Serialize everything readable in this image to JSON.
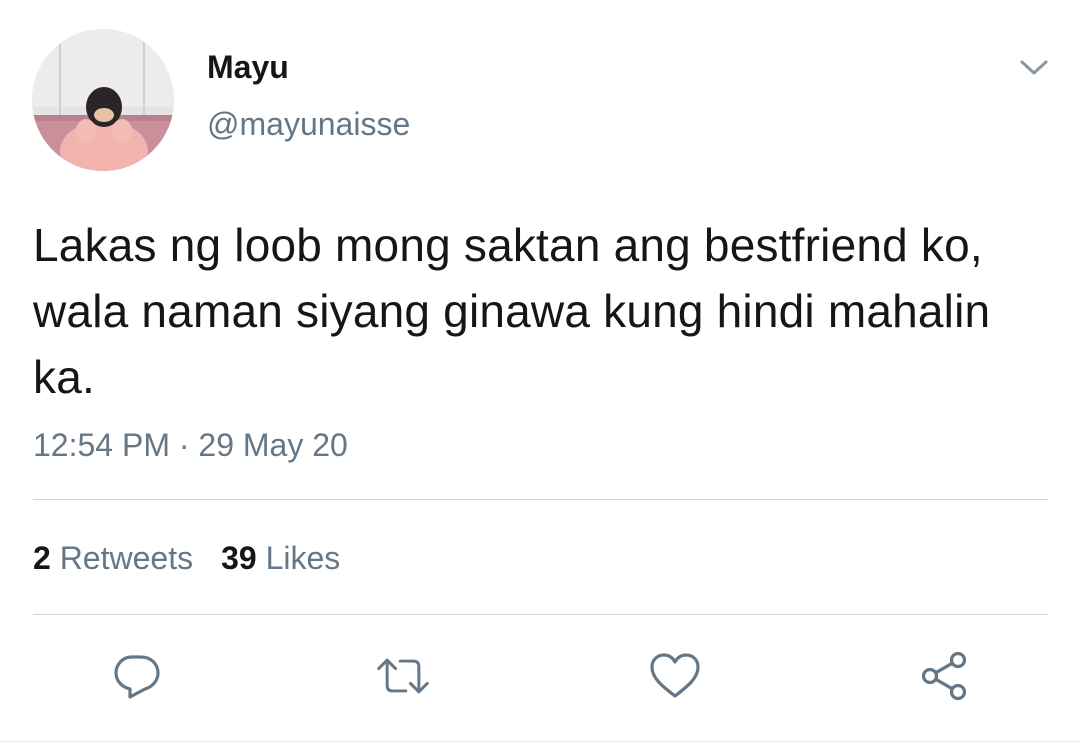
{
  "author": {
    "display_name": "Mayu",
    "handle": "@mayunaisse"
  },
  "tweet": {
    "text": "Lakas ng loob mong saktan ang bestfriend ko, wala naman siyang ginawa kung hindi mahalin ka.",
    "time": "12:54 PM",
    "separator": "·",
    "date": "29 May 20"
  },
  "stats": {
    "retweets_count": "2",
    "retweets_label": "Retweets",
    "likes_count": "39",
    "likes_label": "Likes"
  },
  "actions": {
    "reply_icon": "reply-icon",
    "retweet_icon": "retweet-icon",
    "like_icon": "heart-icon",
    "share_icon": "share-icon"
  },
  "colors": {
    "primary_text": "#14171a",
    "secondary_text": "#657786",
    "divider": "#ccd6dd",
    "icon": "#657786"
  }
}
